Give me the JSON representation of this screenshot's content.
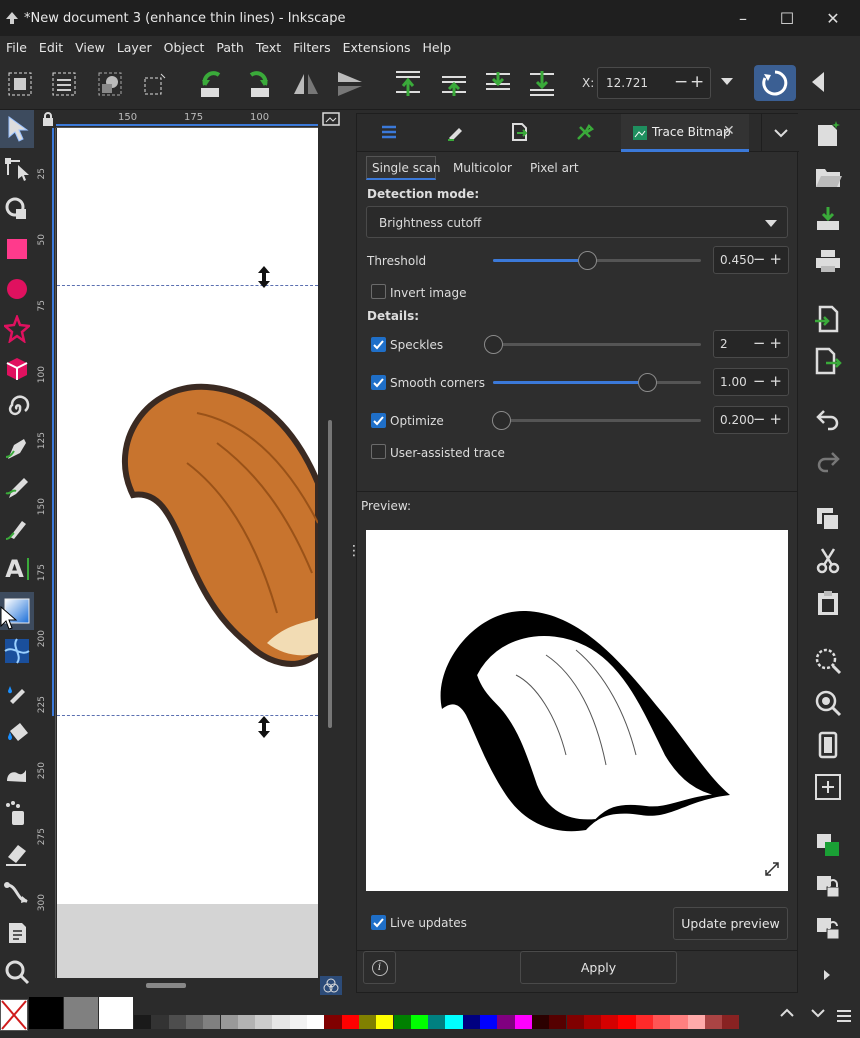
{
  "window": {
    "title": "*New document 3 (enhance thin lines) - Inkscape",
    "controls": [
      "–",
      "☐",
      "✕"
    ]
  },
  "menu": [
    "File",
    "Edit",
    "View",
    "Layer",
    "Object",
    "Path",
    "Text",
    "Filters",
    "Extensions",
    "Help"
  ],
  "toolbar": {
    "x_label": "X:",
    "x_value": "12.721"
  },
  "ruler": {
    "h_ticks": [
      "150",
      "175",
      "100"
    ],
    "v_ticks": [
      "25",
      "50",
      "75",
      "100",
      "125",
      "150",
      "175",
      "200",
      "225",
      "250",
      "275",
      "300"
    ]
  },
  "panel": {
    "tab_active": "Trace Bitmap",
    "modes": [
      "Single scan",
      "Multicolor",
      "Pixel art"
    ],
    "active_mode": "Single scan",
    "detection_label": "Detection mode:",
    "detection_value": "Brightness cutoff",
    "threshold_label": "Threshold",
    "threshold_value": "0.450",
    "threshold_level": 0.45,
    "invert_label": "Invert image",
    "invert_checked": false,
    "details_label": "Details:",
    "speckles_label": "Speckles",
    "speckles_value": "2",
    "speckles_checked": true,
    "speckles_level": 0.0,
    "smooth_label": "Smooth corners",
    "smooth_value": "1.00",
    "smooth_checked": true,
    "smooth_level": 0.74,
    "optimize_label": "Optimize",
    "optimize_value": "0.200",
    "optimize_checked": true,
    "optimize_level": 0.04,
    "user_assisted_label": "User-assisted trace",
    "user_assisted_checked": false,
    "preview_label": "Preview:",
    "live_updates_label": "Live updates",
    "live_updates_checked": true,
    "update_preview_label": "Update preview",
    "apply_label": "Apply",
    "info_label": "i"
  },
  "colors": {
    "accent": "#3b79d9",
    "window_bg": "#2b2b2b",
    "tail_orange": "#c8742e",
    "tail_cream": "#f2dcb4"
  },
  "palette_colors": [
    "#000000",
    "#808080",
    "#ffffff",
    "#1a1a1a",
    "#333333",
    "#4d4d4d",
    "#666666",
    "#808080",
    "#999999",
    "#b3b3b3",
    "#cccccc",
    "#e6e6e6",
    "#f2f2f2",
    "#ffffff",
    "#800000",
    "#ff0000",
    "#808000",
    "#ffff00",
    "#008000",
    "#00ff00",
    "#008080",
    "#00ffff",
    "#000080",
    "#0000ff",
    "#800080",
    "#ff00ff",
    "#2b0000",
    "#550000",
    "#800000",
    "#aa0000",
    "#d40000",
    "#ff0000",
    "#ff2a2a",
    "#ff5555",
    "#ff8080",
    "#ffaaaa",
    "#aa4444",
    "#882222"
  ]
}
